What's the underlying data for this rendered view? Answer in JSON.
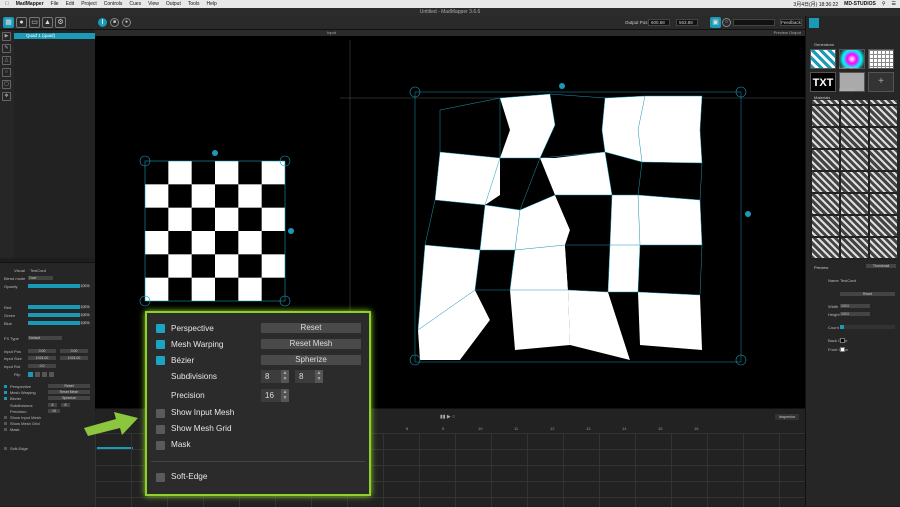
{
  "menubar": {
    "app": "MadMapper",
    "items": [
      "File",
      "Edit",
      "Project",
      "Controls",
      "Cues",
      "View",
      "Output",
      "Tools",
      "Help"
    ],
    "clock": "3月4日(月)  18:36:22",
    "studio": "MD-STUDIOS"
  },
  "window": {
    "title": "Untitled - MadMapper 3.6.6"
  },
  "toolbar": {
    "output_pos_label": "Output Pos",
    "output_x": "600.88",
    "output_y": "563.88",
    "feedback": "Feedback"
  },
  "layers": {
    "selected": "Quad 1 (quad)"
  },
  "views": {
    "input_label": "Input",
    "output_label": "Preview Output",
    "timeline_label": "Inspector",
    "timeline_numbers": [
      "8",
      "9",
      "10",
      "11",
      "12",
      "13",
      "14",
      "15",
      "16"
    ]
  },
  "props": {
    "visual_label": "Visual",
    "visual_value": "TestCard",
    "blend_label": "Blend mode",
    "blend_value": "Over",
    "opacity_label": "Opacity",
    "opacity_value": "100%",
    "red_label": "Red",
    "green_label": "Green",
    "blue_label": "Blue",
    "color_value": "100%",
    "fx_label": "FX Type",
    "fx_value": "Default",
    "input_pos_label": "Input Pos",
    "input_pos_x": "0.00",
    "input_pos_y": "0.00",
    "input_size_label": "Input Size",
    "input_size_x": "1024.00",
    "input_size_y": "1024.00",
    "input_rot_label": "Input Rot",
    "input_rot_value": "0.0",
    "flip_label": "Flip",
    "perspective": "Perspective",
    "mesh_warping": "Mesh Warping",
    "bezier": "Bézier",
    "subdivisions": "Subdivisions",
    "precision": "Precision",
    "show_input_mesh": "Show Input Mesh",
    "show_mesh_grid": "Show Mesh Grid",
    "mask": "Mask",
    "reset": "Reset",
    "reset_mesh": "Reset Mesh",
    "spherize": "Spherize",
    "sub_x": "8",
    "sub_y": "8",
    "precision_value": "16",
    "soft_edge": "Soft-Edge"
  },
  "right": {
    "generators": "Generators",
    "txt": "TXT",
    "color_patterns": "ColorPatterns",
    "grid_gen": "Grid Gen",
    "solid_color": "Solid Color",
    "materials": "Materials",
    "preview": "Preview",
    "thumbnail": "Thumbnail",
    "name_label": "Name",
    "name_value": "TestCard",
    "reset": "Reset",
    "width_label": "Width",
    "width_value": "1024",
    "height_label": "Height",
    "height_value": "1024",
    "count_label": "Count",
    "back_color": "Back Color",
    "front_color": "Front Color"
  },
  "zoom": {
    "perspective": "Perspective",
    "mesh_warping": "Mesh Warping",
    "bezier": "Bézier",
    "subdivisions": "Subdivisions",
    "precision": "Precision",
    "show_input_mesh": "Show Input Mesh",
    "show_mesh_grid": "Show Mesh Grid",
    "mask": "Mask",
    "soft_edge": "Soft-Edge",
    "reset": "Reset",
    "reset_mesh": "Reset Mesh",
    "spherize": "Spherize",
    "sub_x": "8",
    "sub_y": "8",
    "precision_value": "16"
  },
  "colors": {
    "accent": "#1b9ab8",
    "highlight": "#8fd12a",
    "arrow": "#8cc63f"
  }
}
